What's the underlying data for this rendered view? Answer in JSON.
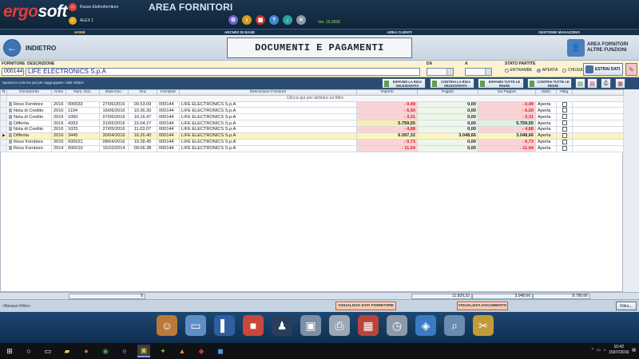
{
  "app": {
    "logo_part1": "ergo",
    "logo_part2": "soft",
    "company": "Russo Elettroforniture",
    "user": "ALEX 1",
    "title": "AREA FORNITORI",
    "version": "Ver. 16.0630"
  },
  "colors": {
    "header": "#1b3550",
    "accent": "#3e74b4",
    "negative": "#e0151f",
    "pink_cell": "#f9d4d6",
    "selected_row": "#fff4c0"
  },
  "nav": {
    "home": "HOME",
    "archivi": "ARCHIVI DI BASE",
    "clienti": "AREA CLIENTI",
    "magazzino": "GESTIONE MAGAZZINO"
  },
  "titlebar": {
    "back_label": "INDIETRO",
    "page_title": "DOCUMENTI E PAGAMENTI",
    "altre_funzioni_1": "AREA FORNITORI",
    "altre_funzioni_2": "ALTRE FUNZIONI"
  },
  "filters": {
    "fornitore_label": "FORNITORE",
    "descrizione_label": "DESCRIZIONE",
    "fornitore_code": "000144",
    "fornitore_desc": "LIFE ELECTRONICS  S.p.A",
    "da_label": "DA",
    "a_label": "A",
    "stato_label": "STATO PARTITE",
    "stato_options": [
      "ENTRAMBE",
      "APERTA",
      "CHIUSA"
    ],
    "stato_selected": "APERTA",
    "estrai_label": "ESTRAI DATI"
  },
  "groupbar": {
    "hint": "Sposta la colonna qui per raggruppare i dati relativi",
    "espandi_riga": "ESPANDI LA RIGA SELEZIONATA",
    "contrai_riga": "CONTRAI LA RIGA SELEZIONATA",
    "espandi_tutte": "ESPANDI TUTTE LE RIGHE",
    "contrai_tutte": "CONTRAI TUTTE LE RIGHE"
  },
  "table": {
    "columns": [
      "Documento",
      "Anno",
      "Num. Doc.",
      "Data Doc.",
      "Ora",
      "Fornitore",
      "Descrizione Fornitore",
      "Importo",
      "Pagato",
      "Da Pagare",
      "Stato",
      "Alleg."
    ],
    "filter_hint": "Clicca qui per definire un filtro",
    "rows": [
      {
        "doc": "Reso Fornitore",
        "anno": "2016",
        "num": "000033",
        "data": "27/06/2016",
        "ora": "09.53.09",
        "forn": "000144",
        "desc": "LIFE ELECTRONICS  S.p.A",
        "importo": "- 0,49",
        "pagato": "0,00",
        "dapagare": "- 0,49",
        "stato": "Aperta"
      },
      {
        "doc": "Nota di Credito",
        "anno": "2016",
        "num": "1104",
        "data": "16/06/2016",
        "ora": "10.36.30",
        "forn": "000144",
        "desc": "LIFE ELECTRONICS  S.p.A",
        "importo": "- 6,50",
        "pagato": "0,00",
        "dapagare": "- 6,50",
        "stato": "Aperta"
      },
      {
        "doc": "Nota di Credito",
        "anno": "2016",
        "num": "1060",
        "data": "07/06/2016",
        "ora": "10.16.47",
        "forn": "000144",
        "desc": "LIFE ELECTRONICS  S.p.A",
        "importo": "- 3,31",
        "pagato": "0,00",
        "dapagare": "- 3,31",
        "stato": "Aperta"
      },
      {
        "doc": "Differita",
        "anno": "2016",
        "num": "4393",
        "data": "31/05/2016",
        "ora": "10.04.27",
        "forn": "000144",
        "desc": "LIFE ELECTRONICS  S.p.A",
        "importo": "5.759,55",
        "pagato": "0,00",
        "dapagare": "5.759,55",
        "stato": "Aperta"
      },
      {
        "doc": "Nota di Credito",
        "anno": "2016",
        "num": "1025",
        "data": "27/05/2016",
        "ora": "11.03.07",
        "forn": "000144",
        "desc": "LIFE ELECTRONICS  S.p.A",
        "importo": "- 4,88",
        "pagato": "0,00",
        "dapagare": "- 4,88",
        "stato": "Aperta"
      },
      {
        "doc": "Differita",
        "anno": "2016",
        "num": "3445",
        "data": "30/04/2016",
        "ora": "16.26.40",
        "forn": "000144",
        "desc": "LIFE ELECTRONICS  S.p.A",
        "importo": "6.097,32",
        "pagato": "3.048,66",
        "dapagare": "3.048,66",
        "stato": "Aperta"
      },
      {
        "doc": "Reso Fornitore",
        "anno": "2016",
        "num": "000021",
        "data": "08/04/2016",
        "ora": "19.28.45",
        "forn": "000144",
        "desc": "LIFE ELECTRONICS  S.p.A",
        "importo": "- 0,73",
        "pagato": "0,00",
        "dapagare": "- 0,73",
        "stato": "Aperta"
      },
      {
        "doc": "Reso Fornitore",
        "anno": "2014",
        "num": "000010",
        "data": "15/10/2014",
        "ora": "09.06.38",
        "forn": "000144",
        "desc": "LIFE ELECTRONICS  S.p.A",
        "importo": "- 11,64",
        "pagato": "0,00",
        "dapagare": "- 11,64",
        "stato": "Aperta"
      }
    ],
    "selected_index": 5
  },
  "totals": {
    "count": "8",
    "importo": "11.829,32",
    "pagato": "3.048,66",
    "dapagare": "8.780,66"
  },
  "footer": {
    "no_filter": "<Nessun Filtro>",
    "visualizza_fornitore": "VISUALIZZA DATI FORNITORE",
    "visualizza_documento": "VISUALIZZA DOCUMENTO",
    "filtro": "Filtro..."
  },
  "dock_icons": [
    "user-icon",
    "card-icon",
    "book-icon",
    "gift-icon",
    "agent-icon",
    "save-icon",
    "printer-icon",
    "calendar-icon",
    "clock-icon",
    "tag-icon",
    "search-icon",
    "tools-icon"
  ],
  "taskbar": {
    "time": "10:42",
    "date": "15/07/2016"
  }
}
